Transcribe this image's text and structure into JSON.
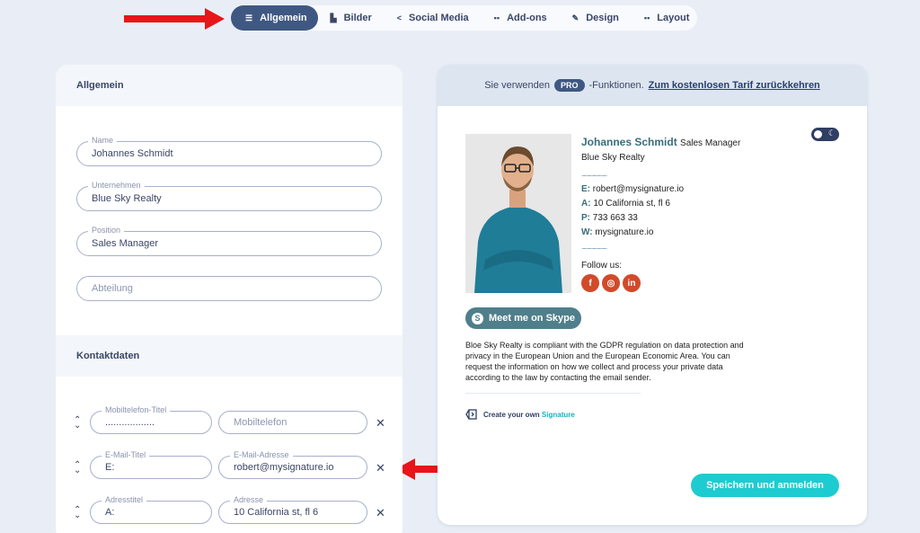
{
  "nav": {
    "tabs": [
      {
        "label": "Allgemein",
        "icon": "list-icon",
        "active": true
      },
      {
        "label": "Bilder",
        "icon": "image-icon",
        "active": false
      },
      {
        "label": "Social Media",
        "icon": "share-icon",
        "active": false
      },
      {
        "label": "Add-ons",
        "icon": "grid-icon",
        "active": false
      },
      {
        "label": "Design",
        "icon": "brush-icon",
        "active": false
      },
      {
        "label": "Layout",
        "icon": "layout-icon",
        "active": false
      }
    ]
  },
  "general": {
    "heading": "Allgemein",
    "fields": [
      {
        "label": "Name",
        "value": "Johannes Schmidt"
      },
      {
        "label": "Unternehmen",
        "value": "Blue Sky Realty"
      },
      {
        "label": "Position",
        "value": "Sales Manager"
      },
      {
        "label": "",
        "placeholder": "Abteilung"
      }
    ]
  },
  "contact": {
    "heading": "Kontaktdaten",
    "rows": [
      {
        "title_label": "Mobiltelefon-Titel",
        "title_value": "..................",
        "value_label": "",
        "value_placeholder": "Mobiltelefon"
      },
      {
        "title_label": "E-Mail-Titel",
        "title_value": "E:",
        "value_label": "E-Mail-Adresse",
        "value_value": "robert@mysignature.io"
      },
      {
        "title_label": "Adresstitel",
        "title_value": "A:",
        "value_label": "Adresse",
        "value_value": "10 California st, fl 6"
      }
    ]
  },
  "preview": {
    "banner_before": "Sie verwenden",
    "banner_badge": "PRO",
    "banner_after": "-Funktionen.",
    "banner_link": "Zum kostenlosen Tarif zurückkehren",
    "signature": {
      "name": "Johannes Schmidt",
      "title": "Sales Manager",
      "company": "Blue Sky Realty",
      "dots": ".......................",
      "email_key": "E:",
      "email": "robert@mysignature.io",
      "address_key": "A:",
      "address": "10 California st, fl 6",
      "phone_key": "P:",
      "phone": "733 663 33",
      "web_key": "W:",
      "web": "mysignature.io",
      "follow": "Follow us:",
      "social": [
        "facebook-icon",
        "instagram-icon",
        "linkedin-icon"
      ]
    },
    "skype_button": "Meet me on Skype",
    "gdpr": "Bloe Sky Realty is compliant with the GDPR regulation on data protection and privacy in the European Union and the European Economic Area. You can request the information on how we collect and process your private data according to the law by contacting the email sender.",
    "create_prefix": "Create your own",
    "create_accent": "Signature",
    "save_button": "Speichern und anmelden"
  },
  "colors": {
    "accent": "#3f5882",
    "save": "#1ecbd0",
    "arrow": "#e8151a",
    "social": "#d14a2a"
  }
}
